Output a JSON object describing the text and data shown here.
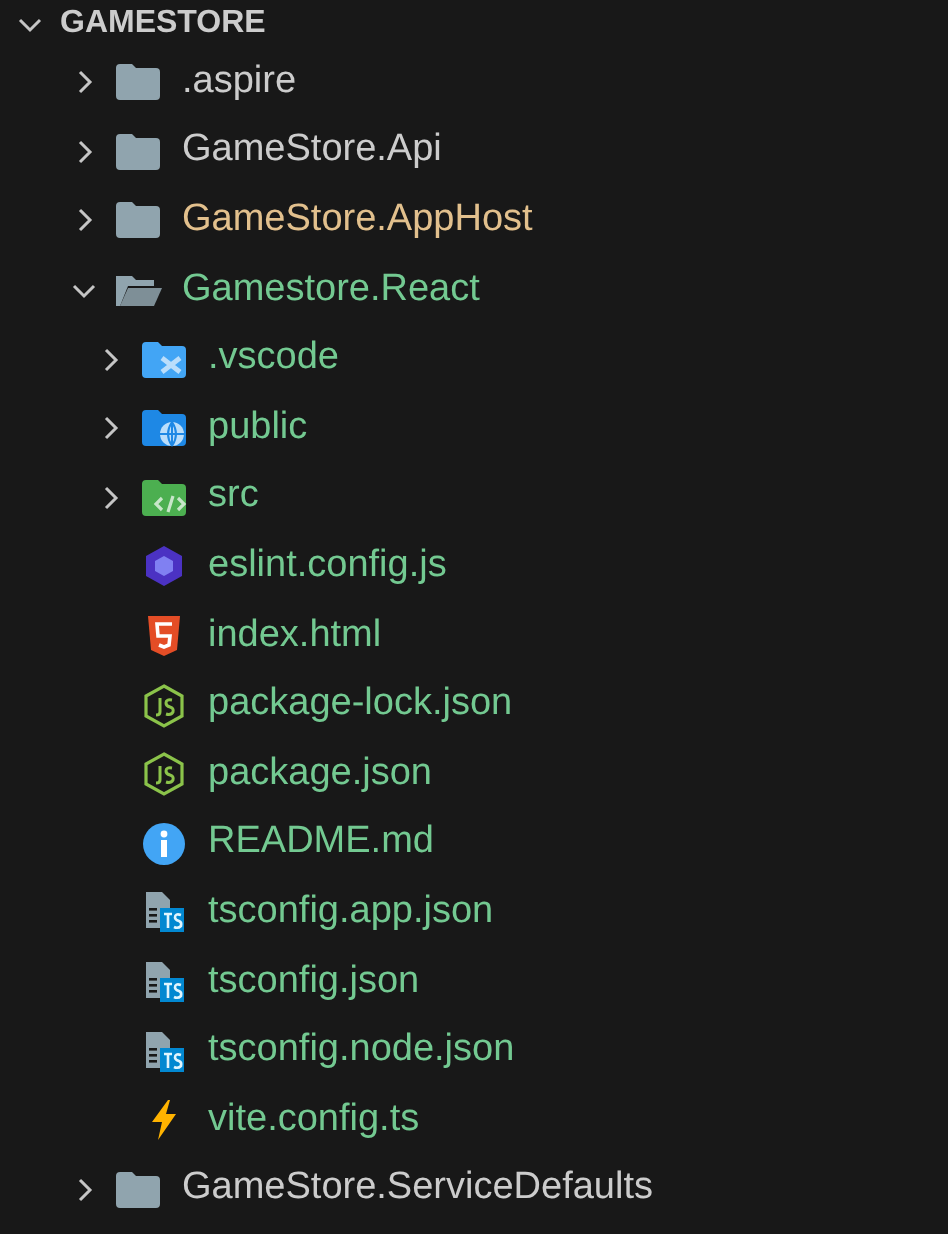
{
  "explorer": {
    "title": "GAMESTORE",
    "expanded": true,
    "children": [
      {
        "name": ".aspire",
        "kind": "folder",
        "color": "#cccccc",
        "expanded": false
      },
      {
        "name": "GameStore.Api",
        "kind": "folder",
        "color": "#cccccc",
        "expanded": false
      },
      {
        "name": "GameStore.AppHost",
        "kind": "folder",
        "color": "#e2c08d",
        "expanded": false
      },
      {
        "name": "Gamestore.React",
        "kind": "folder",
        "color": "#73c991",
        "expanded": true,
        "children": [
          {
            "name": ".vscode",
            "kind": "folder-vscode",
            "color": "#73c991",
            "expanded": false
          },
          {
            "name": "public",
            "kind": "folder-public",
            "color": "#73c991",
            "expanded": false
          },
          {
            "name": "src",
            "kind": "folder-src",
            "color": "#73c991",
            "expanded": false
          },
          {
            "name": "eslint.config.js",
            "kind": "eslint",
            "color": "#73c991"
          },
          {
            "name": "index.html",
            "kind": "html",
            "color": "#73c991"
          },
          {
            "name": "package-lock.json",
            "kind": "js",
            "color": "#73c991"
          },
          {
            "name": "package.json",
            "kind": "js",
            "color": "#73c991"
          },
          {
            "name": "README.md",
            "kind": "info",
            "color": "#73c991"
          },
          {
            "name": "tsconfig.app.json",
            "kind": "ts",
            "color": "#73c991"
          },
          {
            "name": "tsconfig.json",
            "kind": "ts",
            "color": "#73c991"
          },
          {
            "name": "tsconfig.node.json",
            "kind": "ts",
            "color": "#73c991"
          },
          {
            "name": "vite.config.ts",
            "kind": "vite",
            "color": "#73c991"
          }
        ]
      },
      {
        "name": "GameStore.ServiceDefaults",
        "kind": "folder",
        "color": "#cccccc",
        "expanded": false
      }
    ]
  }
}
